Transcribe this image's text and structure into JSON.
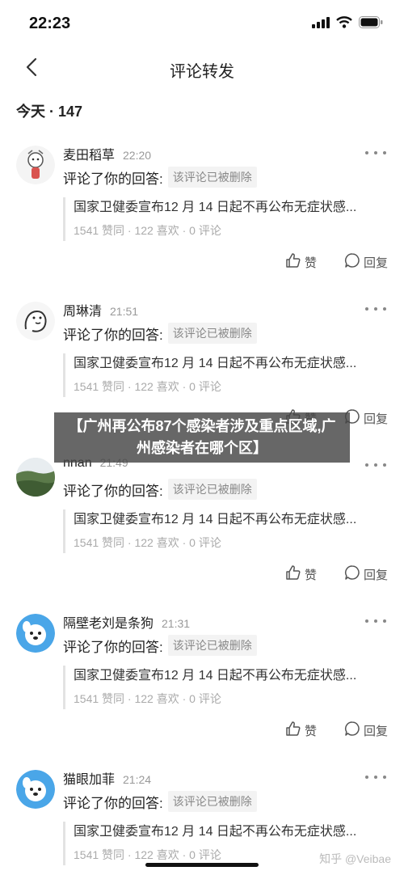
{
  "status_bar": {
    "time": "22:23"
  },
  "nav": {
    "title": "评论转发"
  },
  "section": {
    "header": "今天 · 147"
  },
  "items": [
    {
      "username": "麦田稻草",
      "time": "22:20",
      "comment": "评论了你的回答:",
      "deleted_tag": "该评论已被删除",
      "quote_title": "国家卫健委宣布12 月 14 日起不再公布无症状感...",
      "quote_stats": "1541 赞同 · 122 喜欢 · 0 评论",
      "like_label": "赞",
      "reply_label": "回复",
      "avatar_color": "#ffffff"
    },
    {
      "username": "周琳清",
      "time": "21:51",
      "comment": "评论了你的回答:",
      "deleted_tag": "该评论已被删除",
      "quote_title": "国家卫健委宣布12 月 14 日起不再公布无症状感...",
      "quote_stats": "1541 赞同 · 122 喜欢 · 0 评论",
      "like_label": "赞",
      "reply_label": "回复",
      "avatar_color": "#ffffff"
    },
    {
      "username": "nnan",
      "time": "21:49",
      "comment": "评论了你的回答:",
      "deleted_tag": "该评论已被删除",
      "quote_title": "国家卫健委宣布12 月 14 日起不再公布无症状感...",
      "quote_stats": "1541 赞同 · 122 喜欢 · 0 评论",
      "like_label": "赞",
      "reply_label": "回复",
      "avatar_color": "#5b7a4a"
    },
    {
      "username": "隔壁老刘是条狗",
      "time": "21:31",
      "comment": "评论了你的回答:",
      "deleted_tag": "该评论已被删除",
      "quote_title": "国家卫健委宣布12 月 14 日起不再公布无症状感...",
      "quote_stats": "1541 赞同 · 122 喜欢 · 0 评论",
      "like_label": "赞",
      "reply_label": "回复",
      "avatar_color": "#4aa6e8"
    },
    {
      "username": "猫眼加菲",
      "time": "21:24",
      "comment": "评论了你的回答:",
      "deleted_tag": "该评论已被删除",
      "quote_title": "国家卫健委宣布12 月 14 日起不再公布无症状感...",
      "quote_stats": "1541 赞同 · 122 喜欢 · 0 评论",
      "like_label": "赞",
      "reply_label": "回复",
      "avatar_color": "#4aa6e8"
    }
  ],
  "banner": {
    "text": "【广州再公布87个感染者涉及重点区域,广州感染者在哪个区】"
  },
  "watermark": {
    "text": "知乎 @Veibae"
  }
}
